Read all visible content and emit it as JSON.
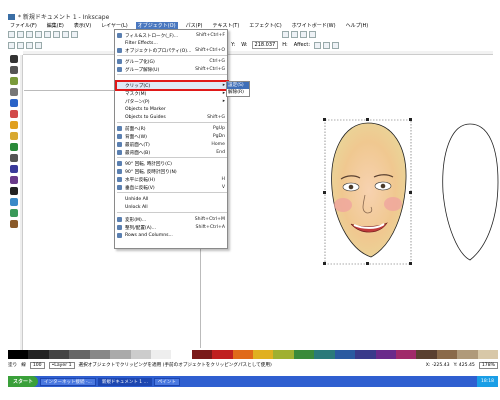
{
  "window": {
    "title": "* 新規ドキュメント 1 - Inkscape"
  },
  "menubar": {
    "items": [
      "ファイル(F)",
      "編集(E)",
      "表示(V)",
      "レイヤー(L)",
      "オブジェクト(O)",
      "パス(P)",
      "テキスト(T)",
      "エフェクト(C)",
      "ホワイトボード(W)",
      "ヘルプ(H)"
    ],
    "active_index": 4
  },
  "toolbar2": {
    "x_label": "X:",
    "y_label": "Y:",
    "w_label": "W:",
    "w_value": "218.037",
    "h_label": "H:",
    "affect_label": "Affect:"
  },
  "object_menu": {
    "items": [
      {
        "label": "フィル&ストローク(_F)...",
        "shortcut": "Shift+Ctrl+F"
      },
      {
        "label": "Filter Effects...",
        "shortcut": ""
      },
      {
        "label": "オブジェクトのプロパティ(O)...",
        "shortcut": "Shift+Ctrl+O"
      },
      {
        "label": "グループ化(G)",
        "shortcut": "Ctrl+G"
      },
      {
        "label": "グループ解除(U)",
        "shortcut": "Shift+Ctrl+G"
      },
      {
        "label": "クリップ(C)",
        "shortcut": ""
      },
      {
        "label": "マスク(M)",
        "shortcut": ""
      },
      {
        "label": "パターン(P)",
        "shortcut": ""
      },
      {
        "label": "Objects to Marker",
        "shortcut": ""
      },
      {
        "label": "Objects to Guides",
        "shortcut": "Shift+G"
      },
      {
        "label": "前面へ(R)",
        "shortcut": "PgUp"
      },
      {
        "label": "背面へ(W)",
        "shortcut": "PgDn"
      },
      {
        "label": "最前面へ(T)",
        "shortcut": "Home"
      },
      {
        "label": "最背面へ(B)",
        "shortcut": "End"
      },
      {
        "label": "90° 回転, 時計回り(C)",
        "shortcut": ""
      },
      {
        "label": "90° 回転, 反時計回り(N)",
        "shortcut": ""
      },
      {
        "label": "水平に反転(H)",
        "shortcut": "H"
      },
      {
        "label": "垂直に反転(V)",
        "shortcut": "V"
      },
      {
        "label": "Unhide All",
        "shortcut": ""
      },
      {
        "label": "Unlock All",
        "shortcut": ""
      },
      {
        "label": "変形(M)...",
        "shortcut": "Shift+Ctrl+M"
      },
      {
        "label": "整列/配置(A)...",
        "shortcut": "Shift+Ctrl+A"
      },
      {
        "label": "Rows and Columns...",
        "shortcut": ""
      }
    ],
    "highlighted_index": 6
  },
  "submenu": {
    "items": [
      "設定(S)",
      "解除(R)"
    ],
    "selected_index": 0
  },
  "status": {
    "fill_label": "塗り",
    "stroke_label": "線",
    "opacity": "100",
    "layer": "•Layer 1",
    "message": "選択オブジェクトでクリッピングを適用 (手前のオブジェクトをクリッピングパスとして使用)",
    "x_coord": "X: -225.43",
    "y_coord": "Y: 425.45",
    "zoom": "178%"
  },
  "taskbar": {
    "start_label": "スタート",
    "tasks": [
      "インターネット接続 -...",
      "新規ドキュメント 1 ...",
      "ペイント"
    ],
    "active_task": 1,
    "clock": "18:18"
  },
  "colors": {
    "accent": "#4a78c0",
    "highlight_outline": "#e01818",
    "taskbar": "#2f5fd0",
    "start": "#3aa03a"
  }
}
